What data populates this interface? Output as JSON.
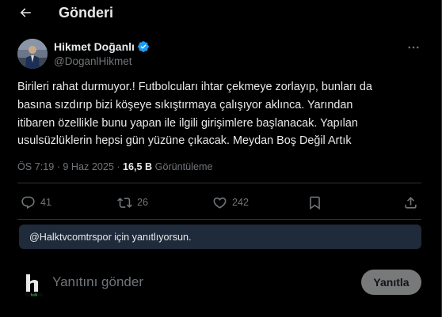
{
  "header": {
    "title": "Gönderi",
    "back_icon": "arrow-left-icon"
  },
  "author": {
    "display_name": "Hikmet Doğanlı",
    "handle": "@DoganlHikmet",
    "verified_color": "#1d9bf0"
  },
  "tweet": {
    "text": "Birileri rahat durmuyor.! Futbolcuları ihtar çekmeye zorlayıp, bunları da\nbasına sızdırıp bizi köşeye sıkıştırmaya çalışıyor aklınca. Yarından\nitibaren özellikle bunu yapan ile ilgili girişimlere başlanacak. Yapılan\nusulsüzlüklerin hepsi gün yüzüne çıkacak. Meydan Boş Değil Artık",
    "time": "ÖS 7:19",
    "separator": "·",
    "date": "9 Haz 2025",
    "views_count": "16,5 B",
    "views_label": "Görüntüleme"
  },
  "actions": {
    "replies": "41",
    "reposts": "26",
    "likes": "242"
  },
  "reply_note": "@Halktvcomtrspor için yanıtlıyorsun.",
  "composer": {
    "placeholder": "Yanıtını gönder",
    "button_label": "Yanıtla",
    "logo_text": "halk"
  },
  "colors": {
    "background": "#000000",
    "text": "#e7e9ea",
    "muted": "#71767b",
    "border": "#2f3336",
    "note_bg": "#1f2a3a",
    "button_disabled": "#787a7a"
  }
}
